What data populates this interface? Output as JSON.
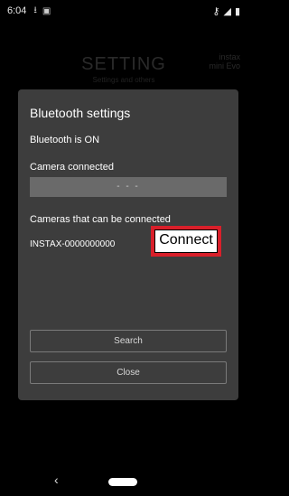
{
  "status_bar": {
    "time": "6:04",
    "notification_icons": [
      "download-icon",
      "sim-icon"
    ],
    "right_icons": [
      "key-icon",
      "signal-icon",
      "battery-icon"
    ]
  },
  "background": {
    "title": "SETTING",
    "subtitle": "Settings and others",
    "brand_line1": "instax",
    "brand_line2": "mini Evo"
  },
  "dialog": {
    "title": "Bluetooth settings",
    "bluetooth_status": "Bluetooth is ON",
    "camera_connected_label": "Camera connected",
    "camera_connected_value": "- - -",
    "available_label": "Cameras that can be connected",
    "device_name": "INSTAX-0000000000",
    "connect_label": "Connect",
    "search_label": "Search",
    "close_label": "Close",
    "highlight_color": "#d91f2a"
  },
  "nav_bar": {
    "back_icon": "‹"
  }
}
